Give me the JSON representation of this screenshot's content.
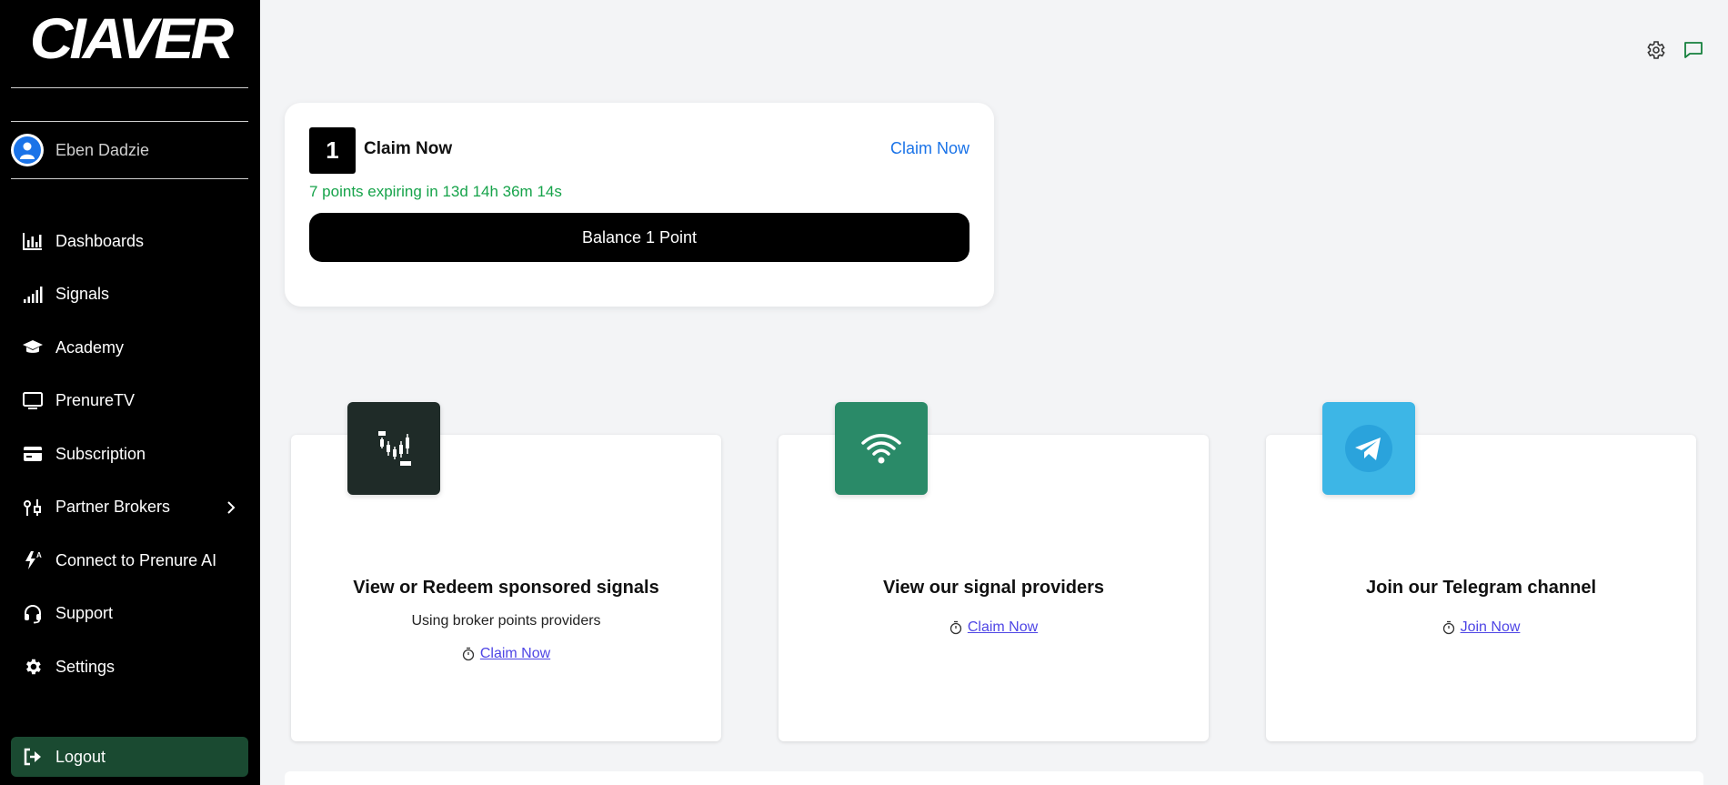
{
  "sidebar": {
    "logo": "CIAVER",
    "user": {
      "name": "Eben Dadzie"
    },
    "items": [
      {
        "label": "Dashboards",
        "icon": "bar-chart-icon"
      },
      {
        "label": "Signals",
        "icon": "signal-bars-icon"
      },
      {
        "label": "Academy",
        "icon": "graduation-cap-icon"
      },
      {
        "label": "PrenureTV",
        "icon": "monitor-icon"
      },
      {
        "label": "Subscription",
        "icon": "credit-card-icon"
      },
      {
        "label": "Partner Brokers",
        "icon": "brokers-icon"
      },
      {
        "label": "Connect to Prenure AI",
        "icon": "ai-bolt-icon"
      },
      {
        "label": "Support",
        "icon": "headset-icon"
      },
      {
        "label": "Settings",
        "icon": "gear-icon"
      }
    ],
    "logout_label": "Logout"
  },
  "claim": {
    "number": "1",
    "title": "Claim Now",
    "link": "Claim Now",
    "expiring": "7 points expiring in 13d 14h 36m 14s",
    "balance": "Balance 1 Point"
  },
  "cards": [
    {
      "title": "View or Redeem sponsored signals",
      "subtitle": "Using broker points providers",
      "link": "Claim Now",
      "color": "#1f2b28"
    },
    {
      "title": "View our signal providers",
      "link": "Claim Now",
      "color": "#2a8a68"
    },
    {
      "title": "Join our Telegram channel",
      "link": "Join Now",
      "color": "#3db6e6"
    }
  ],
  "colors": {
    "sidebar_bg": "#000000",
    "logout_bg": "#1a4a31",
    "accent_blue": "#1a73e8",
    "accent_green": "#16a34a"
  }
}
